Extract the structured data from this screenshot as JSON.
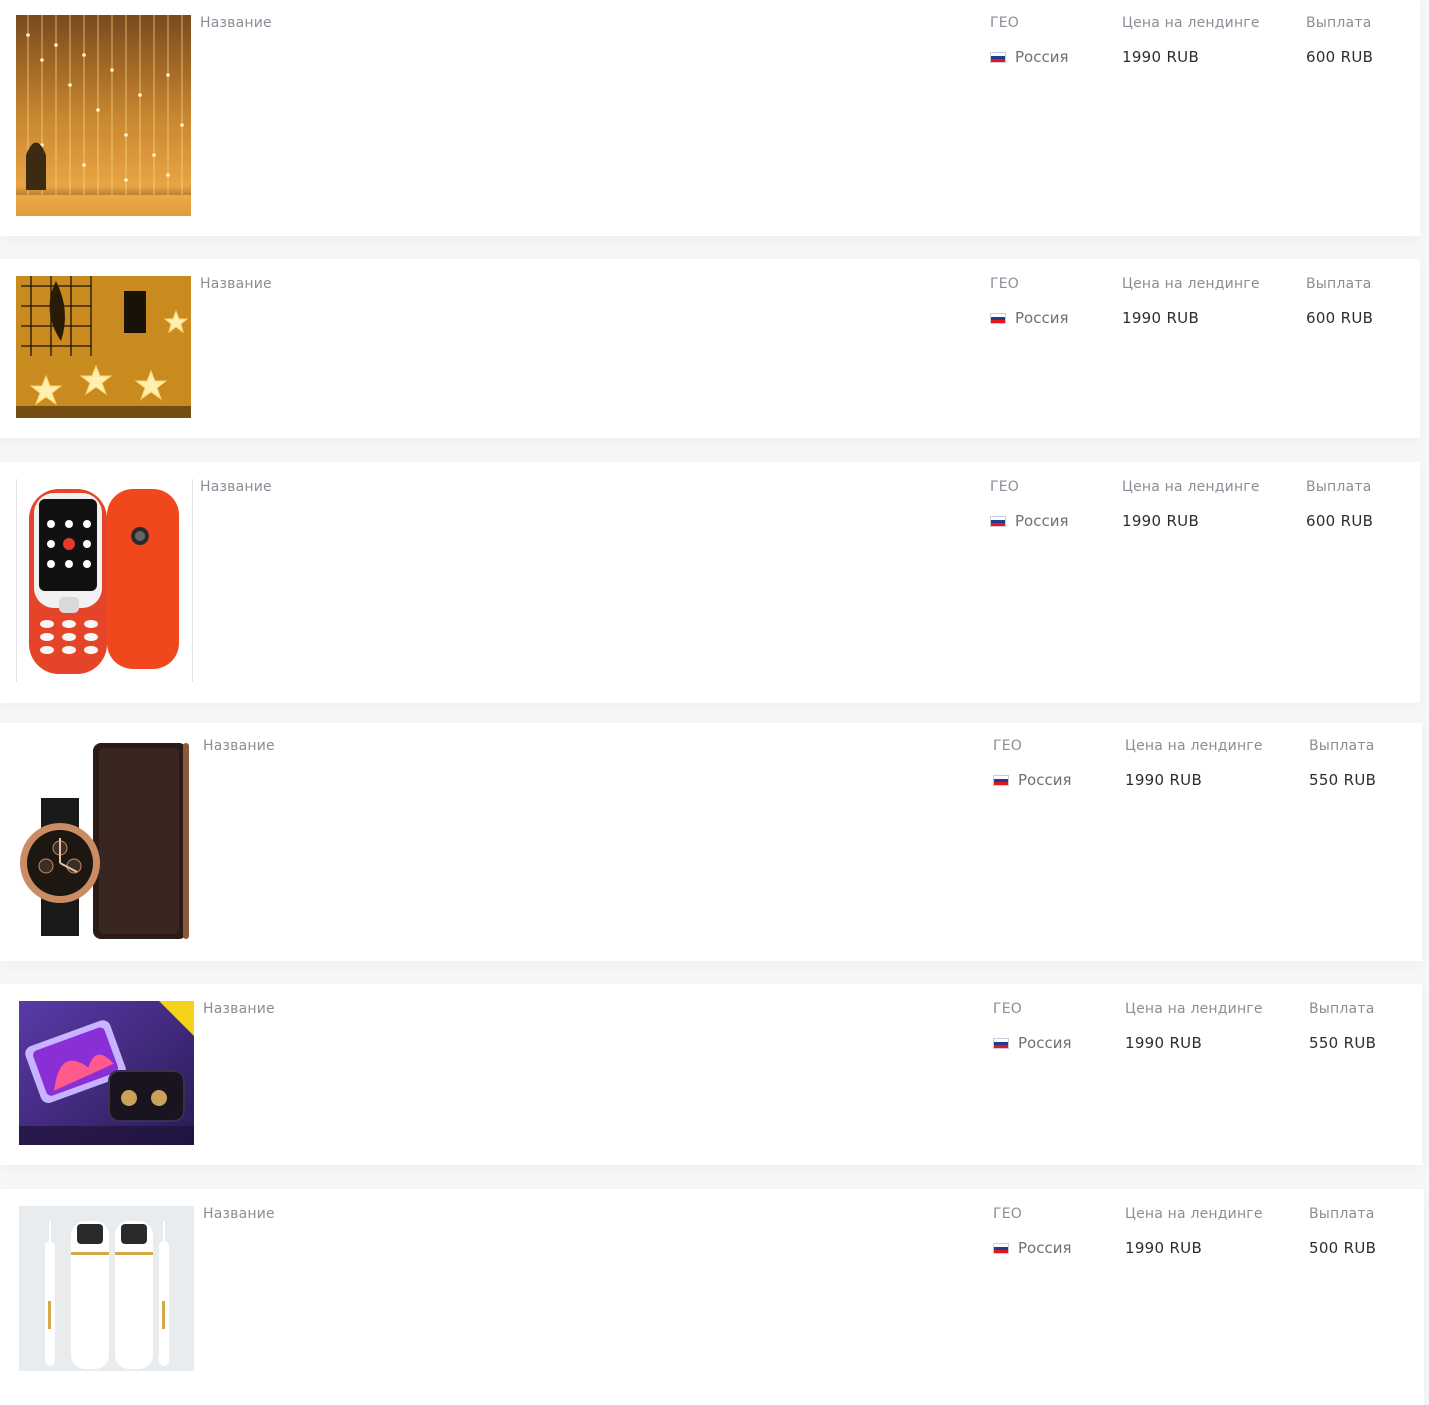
{
  "columns": {
    "name": "Название",
    "geo": "ГЕО",
    "landing_price": "Цена на лендинге",
    "payout": "Выплата"
  },
  "flag_colors": [
    "#ffffff",
    "#1c3f94",
    "#e4181c"
  ],
  "offers": [
    {
      "thumb_icon": "fairy-light-curtain-image",
      "geo": "Россия",
      "landing_price": "1990 RUB",
      "payout": "600 RUB"
    },
    {
      "thumb_icon": "star-lights-image",
      "geo": "Россия",
      "landing_price": "1990 RUB",
      "payout": "600 RUB"
    },
    {
      "thumb_icon": "red-mobile-phone-image",
      "geo": "Россия",
      "landing_price": "1990 RUB",
      "payout": "600 RUB"
    },
    {
      "thumb_icon": "watch-and-wallet-image",
      "geo": "Россия",
      "landing_price": "1990 RUB",
      "payout": "550 RUB"
    },
    {
      "thumb_icon": "power-bank-earbuds-image",
      "geo": "Россия",
      "landing_price": "1990 RUB",
      "payout": "550 RUB"
    },
    {
      "thumb_icon": "ultrasonic-skin-scrubber-image",
      "geo": "Россия",
      "landing_price": "1990 RUB",
      "payout": "500 RUB"
    }
  ]
}
